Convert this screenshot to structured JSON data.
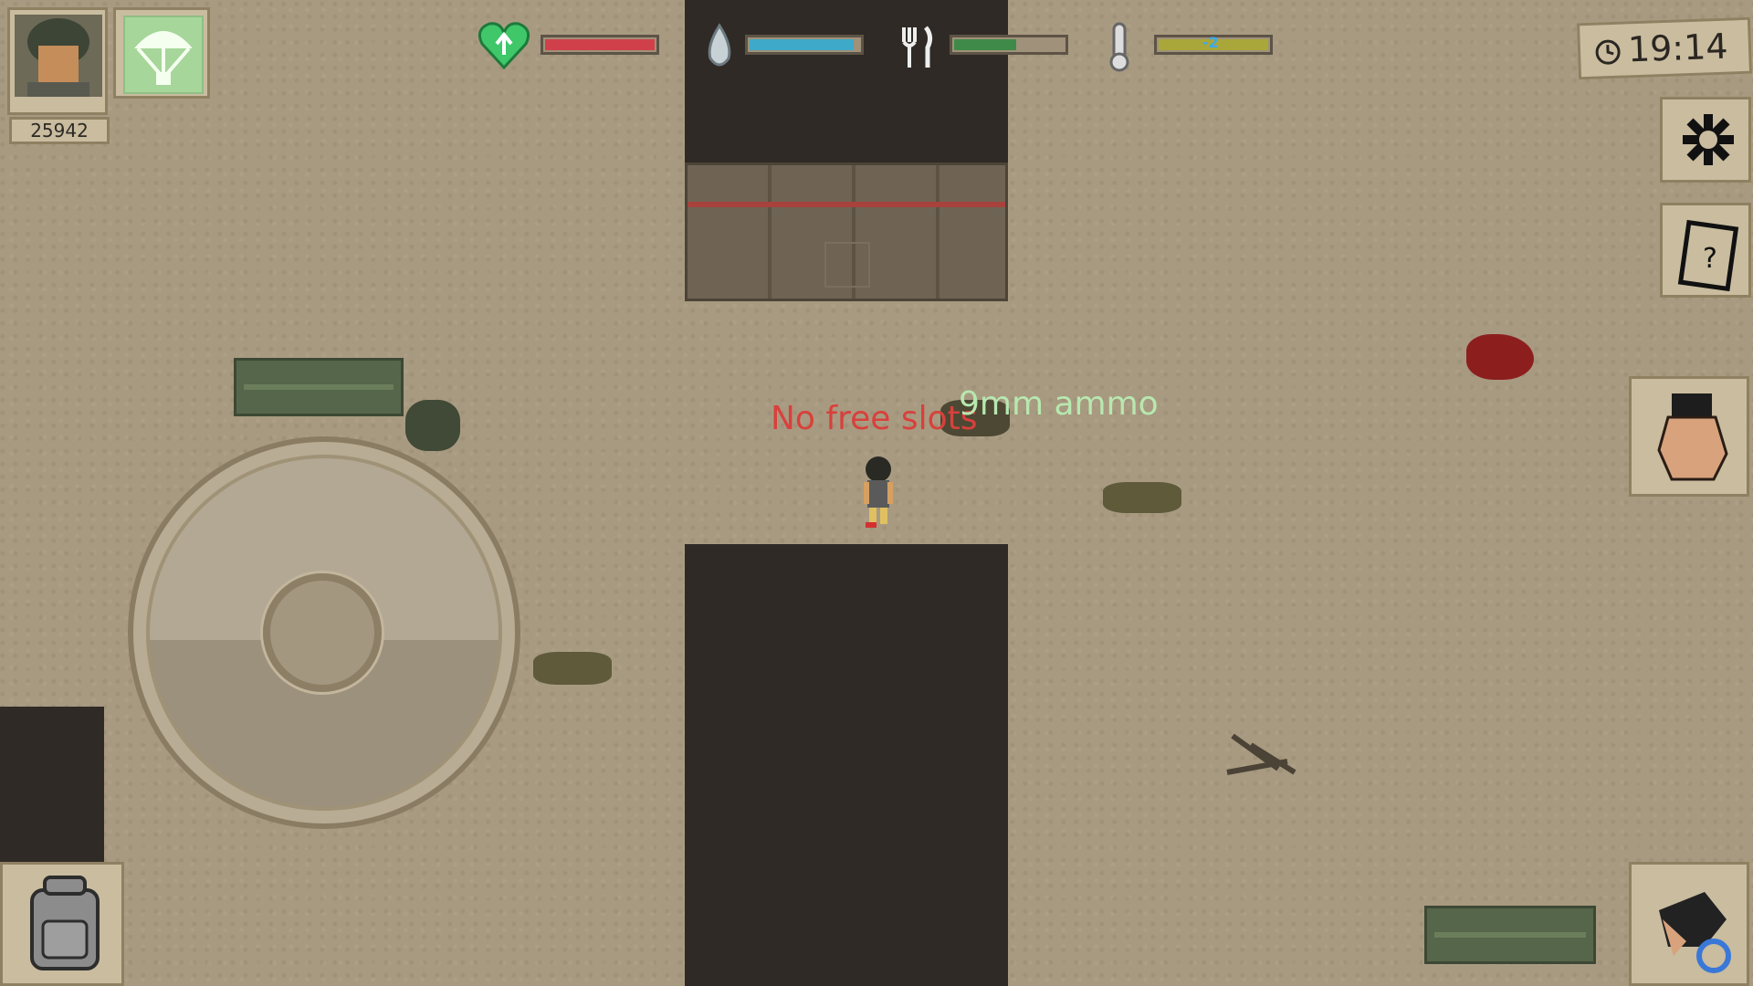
{
  "hud": {
    "score": "25942",
    "clock": "19:14",
    "stats": [
      {
        "name": "health",
        "icon": "heart-icon",
        "color": "#d0404a",
        "level": 1.0
      },
      {
        "name": "water",
        "icon": "water-drop-icon",
        "color": "#3ea9c9",
        "level": 0.95
      },
      {
        "name": "food",
        "icon": "fork-knife-icon",
        "color": "#3f8a48",
        "level": 0.55
      },
      {
        "name": "temperature",
        "icon": "thermometer-icon",
        "color": "#a9a73a",
        "level": 1.0,
        "marker": "-2"
      }
    ]
  },
  "messages": {
    "error": "No free slots",
    "pickup": "9mm ammo"
  },
  "colors": {
    "ground": "#a89a80",
    "dark_area": "#2f2a25",
    "error_text": "#d9403c",
    "pickup_text": "#b7e8b0"
  },
  "buttons": {
    "settings": "gear-icon",
    "quests": "notepad-question-icon",
    "interact": "grab-hand-icon",
    "swap": "swap-hand-icon",
    "inventory": "backpack-icon",
    "airdrop": "parachute-icon"
  }
}
